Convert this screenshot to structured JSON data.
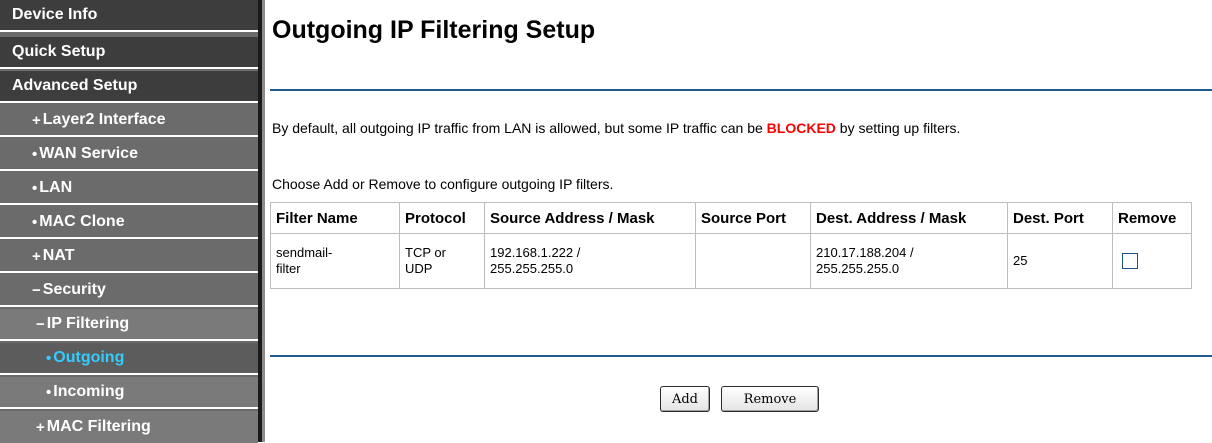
{
  "sidebar": {
    "items": [
      {
        "label": "Device Info",
        "bullet": ""
      },
      {
        "label": "Quick Setup",
        "bullet": ""
      },
      {
        "label": "Advanced Setup",
        "bullet": ""
      },
      {
        "label": "Layer2 Interface",
        "bullet": "+"
      },
      {
        "label": "WAN Service",
        "bullet": "•"
      },
      {
        "label": "LAN",
        "bullet": "•"
      },
      {
        "label": "MAC Clone",
        "bullet": "•"
      },
      {
        "label": "NAT",
        "bullet": "+"
      },
      {
        "label": "Security",
        "bullet": "−"
      },
      {
        "label": "IP Filtering",
        "bullet": "−"
      },
      {
        "label": "Outgoing",
        "bullet": "•",
        "active": true
      },
      {
        "label": "Incoming",
        "bullet": "•"
      },
      {
        "label": "MAC Filtering",
        "bullet": "+"
      }
    ]
  },
  "main": {
    "title": "Outgoing IP Filtering Setup",
    "desc_prefix": "By default, all outgoing IP traffic from LAN is allowed, but some IP traffic can be ",
    "desc_blocked": "BLOCKED",
    "desc_suffix": " by setting up filters.",
    "instruction": "Choose Add or Remove to configure outgoing IP filters."
  },
  "table": {
    "headers": [
      "Filter Name",
      "Protocol",
      "Source Address / Mask",
      "Source Port",
      "Dest. Address / Mask",
      "Dest. Port",
      "Remove"
    ],
    "rows": [
      {
        "filter_name_1": "sendmail-",
        "filter_name_2": "filter",
        "protocol_1": "TCP or",
        "protocol_2": "UDP",
        "source_1": "192.168.1.222 /",
        "source_2": "255.255.255.0",
        "source_port": "",
        "dest_1": "210.17.188.204 /",
        "dest_2": "255.255.255.0",
        "dest_port": "25",
        "remove_checked": false
      }
    ]
  },
  "buttons": {
    "add_label": "Add",
    "remove_label": "Remove"
  },
  "colors": {
    "sidebar_top": "#3d3d3d",
    "sidebar_sub": "#6b6b6b",
    "active_text": "#33ccff",
    "divider": "#1e5b8c",
    "blocked": "#ff0000"
  }
}
